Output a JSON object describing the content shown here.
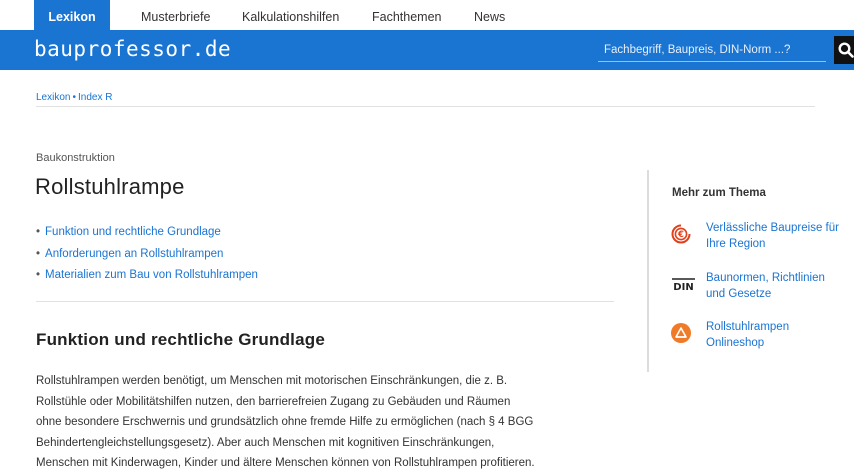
{
  "topnav": {
    "tabs": [
      {
        "label": "Lexikon",
        "active": true
      },
      {
        "label": "Musterbriefe",
        "active": false
      },
      {
        "label": "Kalkulationshilfen",
        "active": false
      },
      {
        "label": "Fachthemen",
        "active": false
      },
      {
        "label": "News",
        "active": false
      }
    ]
  },
  "header": {
    "logo": "bauprofessor.de",
    "search_placeholder": "Fachbegriff, Baupreis, DIN-Norm ...?"
  },
  "breadcrumb": {
    "items": [
      "Lexikon",
      "Index R"
    ],
    "separator": "•"
  },
  "article": {
    "category": "Baukonstruktion",
    "title": "Rollstuhlrampe",
    "toc_bullet": "•",
    "toc": [
      "Funktion und rechtliche Grundlage",
      "Anforderungen an Rollstuhlrampen",
      "Materialien zum Bau von Rollstuhlrampen"
    ],
    "section_heading": "Funktion und rechtliche Grundlage",
    "paragraph_lines": [
      "Rollstuhlrampen werden benötigt, um Menschen mit motorischen Einschränkungen, die z. B.",
      "Rollstühle oder Mobilitätshilfen nutzen, den barrierefreien Zugang zu Gebäuden und Räumen",
      "ohne besondere Erschwernis und grundsätzlich ohne fremde Hilfe zu ermöglichen (nach § 4 BGG",
      "Behindertengleichstellungsgesetz). Aber auch Menschen mit kognitiven Einschränkungen,",
      "Menschen mit Kinderwagen, Kinder und ältere Menschen können von Rollstuhlrampen profitieren."
    ]
  },
  "sidebar": {
    "title": "Mehr zum Thema",
    "items": [
      {
        "icon": "euro-price-icon",
        "label": "Verlässliche Baupreise für Ihre Region"
      },
      {
        "icon": "din-icon",
        "icon_text": "DIN",
        "label": "Baunormen, Richtlinien und Gesetze"
      },
      {
        "icon": "shop-icon",
        "label": "Rollstuhlrampen Onlineshop"
      }
    ]
  },
  "colors": {
    "brand_blue": "#1a74d2",
    "accent_red": "#e2401c",
    "accent_orange": "#f07a28"
  }
}
